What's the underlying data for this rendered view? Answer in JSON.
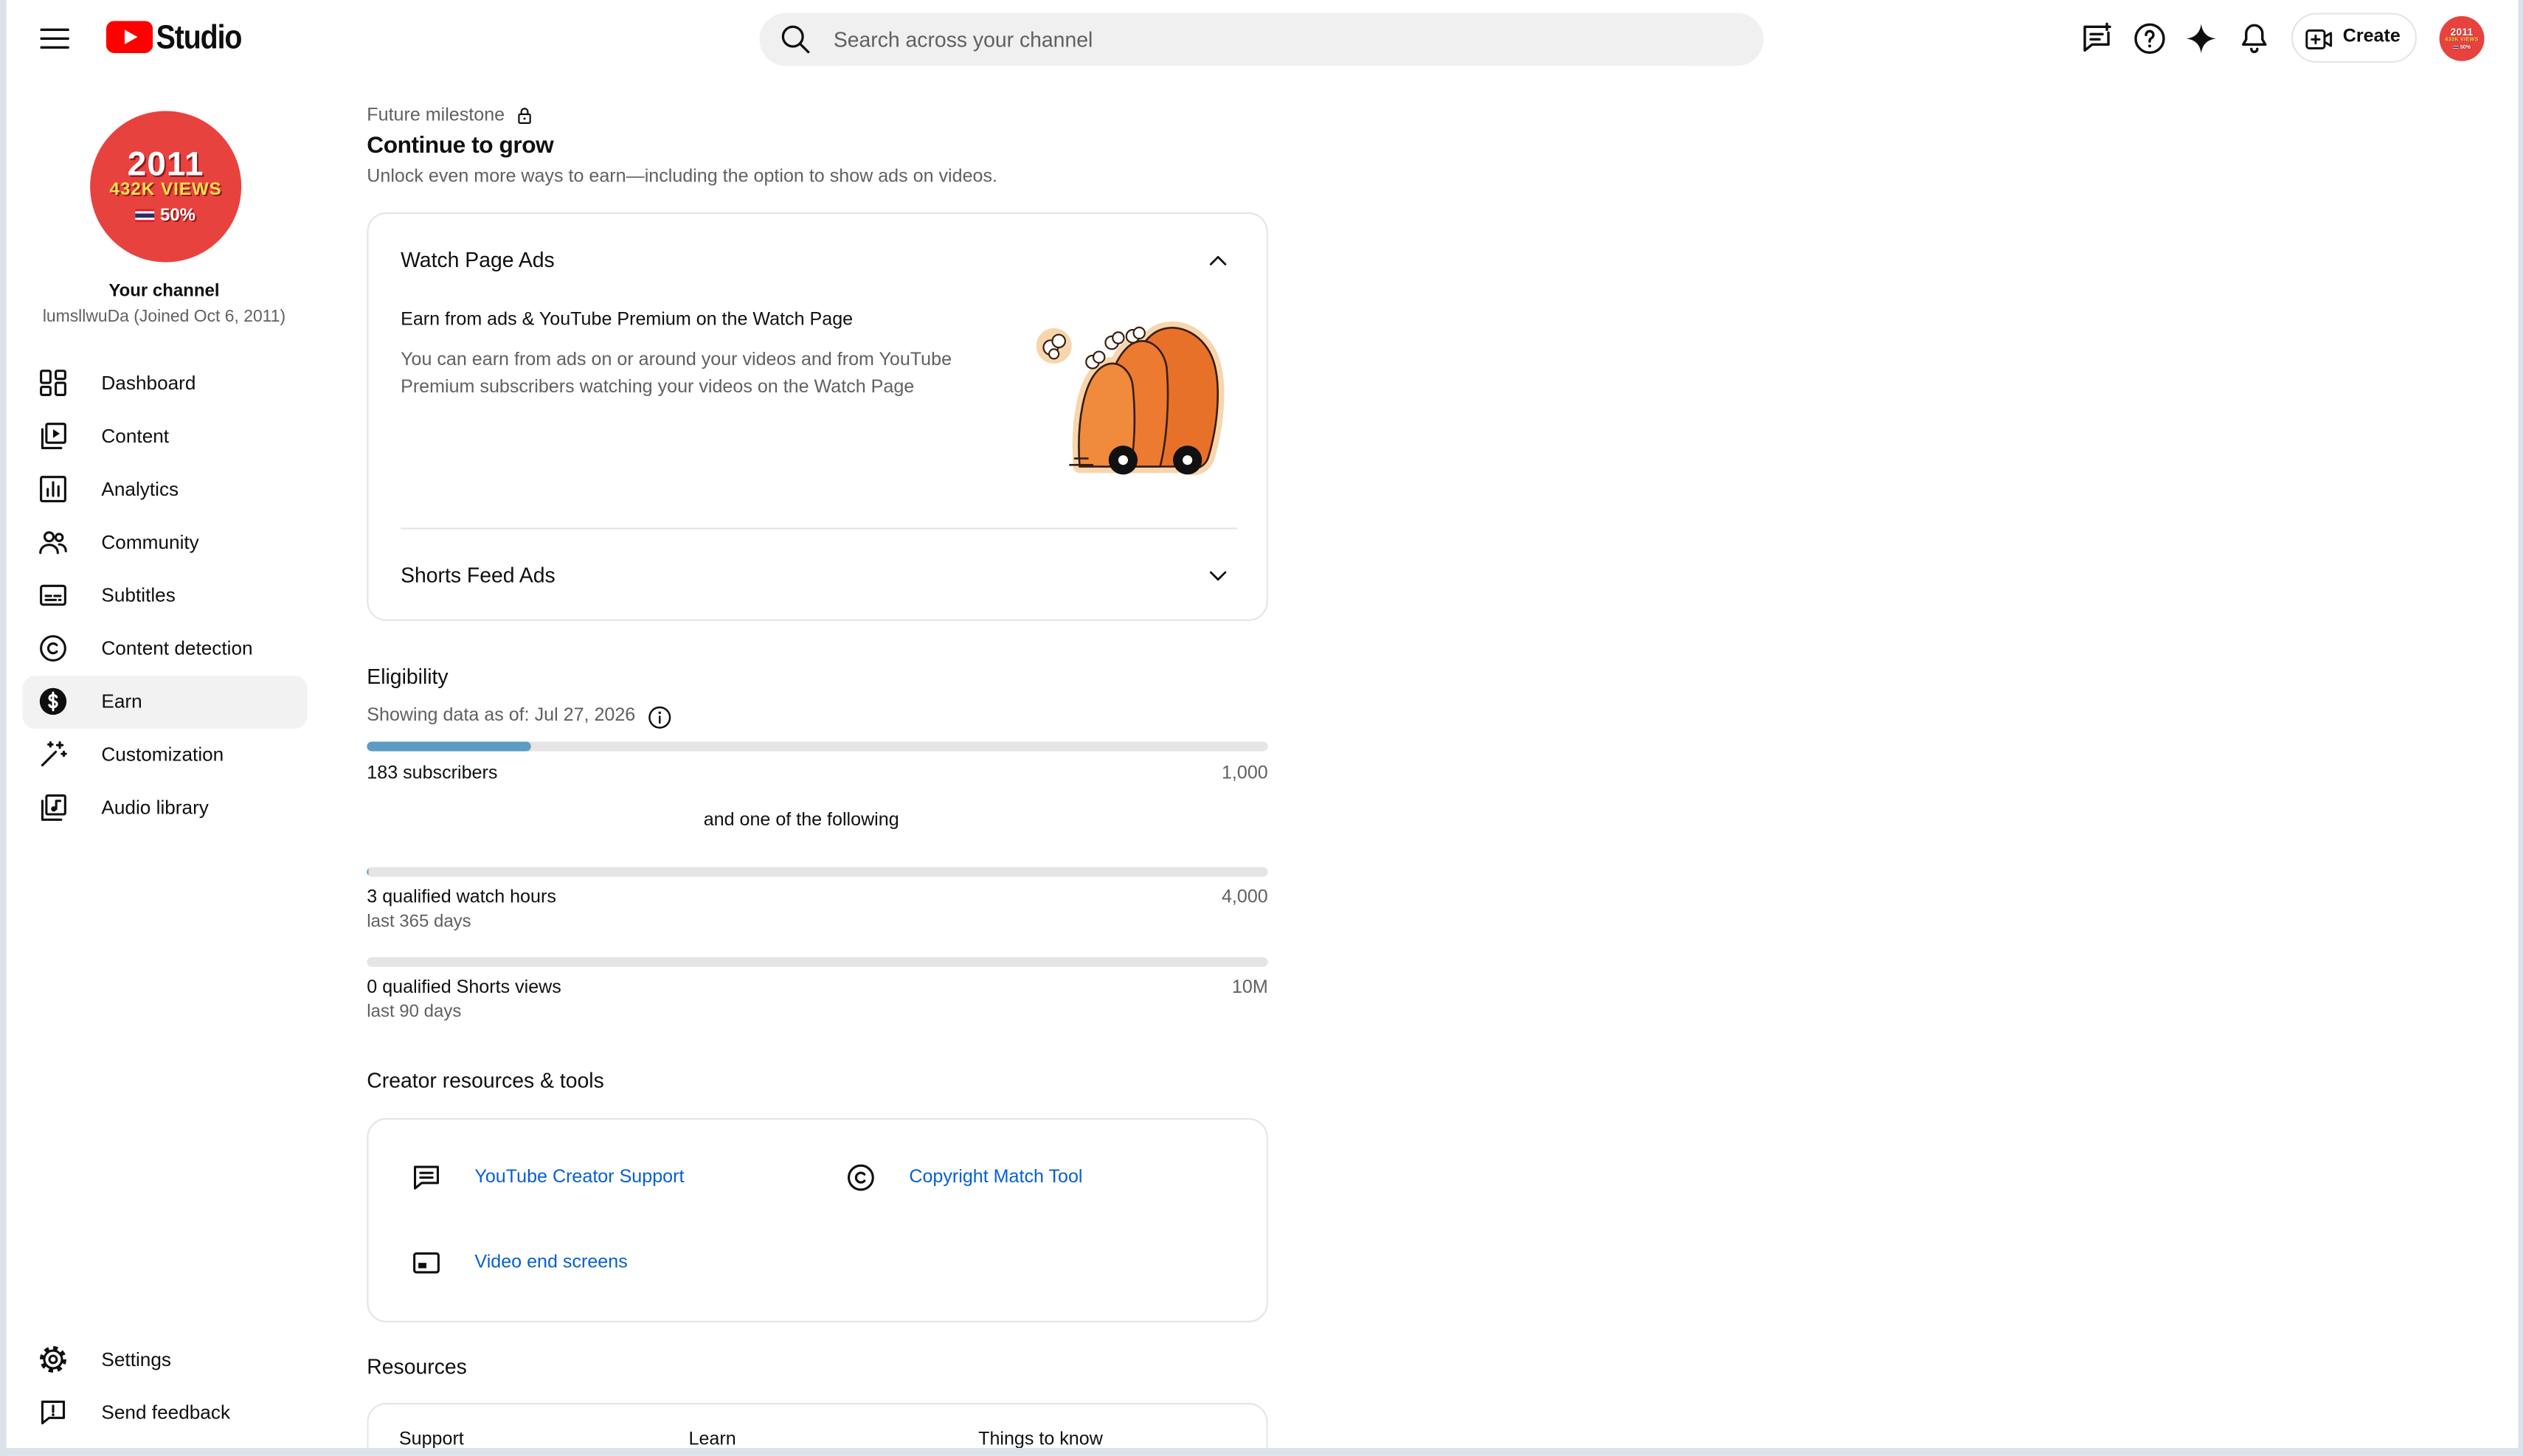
{
  "header": {
    "logo_text": "Studio",
    "search_placeholder": "Search across your channel",
    "create_label": "Create"
  },
  "channel": {
    "avatar": {
      "year": "2011",
      "views": "432K VIEWS",
      "percent": "50%"
    },
    "label": "Your channel",
    "name": "lumsllwuDa (Joined Oct 6, 2011)"
  },
  "sidebar": {
    "items": [
      {
        "label": "Dashboard",
        "icon": "dashboard-icon",
        "active": false
      },
      {
        "label": "Content",
        "icon": "content-icon",
        "active": false
      },
      {
        "label": "Analytics",
        "icon": "analytics-icon",
        "active": false
      },
      {
        "label": "Community",
        "icon": "community-icon",
        "active": false
      },
      {
        "label": "Subtitles",
        "icon": "subtitles-icon",
        "active": false
      },
      {
        "label": "Content detection",
        "icon": "content-detection-icon",
        "active": false
      },
      {
        "label": "Earn",
        "icon": "earn-icon",
        "active": true
      },
      {
        "label": "Customization",
        "icon": "customization-icon",
        "active": false
      },
      {
        "label": "Audio library",
        "icon": "audio-library-icon",
        "active": false
      }
    ],
    "footer": [
      {
        "label": "Settings",
        "icon": "gear-icon"
      },
      {
        "label": "Send feedback",
        "icon": "feedback-icon"
      }
    ]
  },
  "milestone": {
    "eyebrow": "Future milestone",
    "title": "Continue to grow",
    "subtitle": "Unlock even more ways to earn—including the option to show ads on videos."
  },
  "ad_formats": {
    "watch_page": {
      "title": "Watch Page Ads",
      "expanded": true,
      "heading": "Earn from ads & YouTube Premium on the Watch Page",
      "body": "You can earn from ads on or around your videos and from YouTube Premium subscribers watching your videos on the Watch Page"
    },
    "shorts_feed": {
      "title": "Shorts Feed Ads",
      "expanded": false
    }
  },
  "eligibility": {
    "title": "Eligibility",
    "as_of": "Showing data as of: Jul 27, 2026",
    "primary": {
      "label": "183 subscribers",
      "target_label": "1,000",
      "current": 183,
      "target": 1000
    },
    "connector": "and one of the following",
    "alternatives": [
      {
        "label": "3 qualified watch hours",
        "period": "last 365 days",
        "target_label": "4,000",
        "current": 3,
        "target": 4000
      },
      {
        "label": "0 qualified Shorts views",
        "period": "last 90 days",
        "target_label": "10M",
        "current": 0,
        "target": 10000000
      }
    ]
  },
  "tools": {
    "title": "Creator resources & tools",
    "links": [
      {
        "label": "YouTube Creator Support",
        "icon": "support-chat-icon"
      },
      {
        "label": "Copyright Match Tool",
        "icon": "copyright-icon"
      },
      {
        "label": "Video end screens",
        "icon": "end-screen-icon"
      }
    ]
  },
  "resources": {
    "title": "Resources",
    "columns": [
      "Support",
      "Learn",
      "Things to know"
    ]
  },
  "colors": {
    "brand_red": "#ff0000",
    "avatar_red": "#e8423f",
    "link": "#065fd4",
    "progress_fill": "#5b9bc4",
    "track": "#e5e5e5",
    "selected_bg": "#f2f2f2"
  }
}
